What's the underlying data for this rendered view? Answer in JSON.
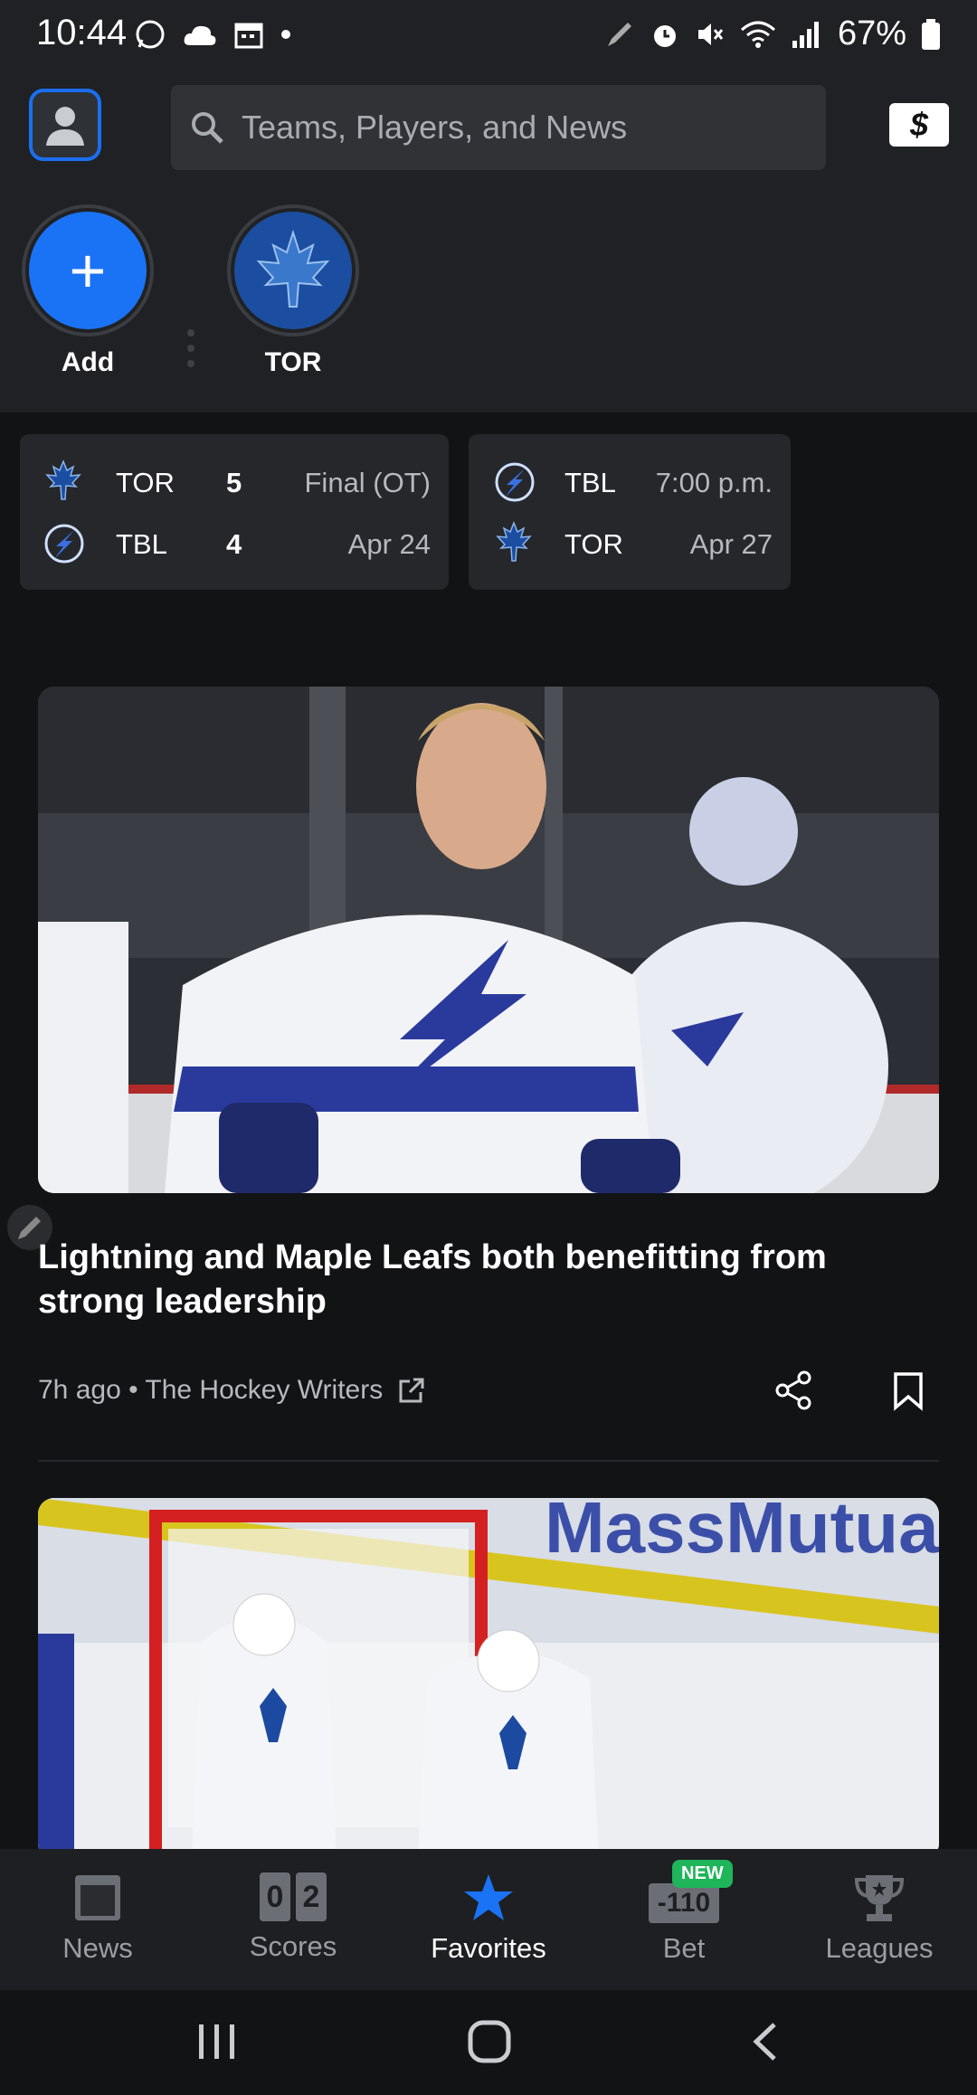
{
  "status_bar": {
    "time": "10:44",
    "battery": "67%"
  },
  "header": {
    "search_placeholder": "Teams, Players, and News",
    "favorites": [
      {
        "label": "Add"
      },
      {
        "label": "TOR"
      }
    ]
  },
  "games": [
    {
      "rows": [
        {
          "team": "TOR",
          "score": "5",
          "info": "Final (OT)"
        },
        {
          "team": "TBL",
          "score": "4",
          "info": "Apr 24"
        }
      ]
    },
    {
      "rows": [
        {
          "team": "TBL",
          "info": "7:00 p.m."
        },
        {
          "team": "TOR",
          "info": "Apr 27"
        }
      ]
    }
  ],
  "articles": [
    {
      "headline": "Lightning and Maple Leafs both benefitting from strong leadership",
      "meta": "7h ago • The Hockey Writers"
    },
    {
      "banner_text": "MassMutual"
    }
  ],
  "tabs": [
    {
      "label": "News"
    },
    {
      "label": "Scores",
      "score_a": "0",
      "score_b": "2"
    },
    {
      "label": "Favorites"
    },
    {
      "label": "Bet",
      "badge": "NEW",
      "odds": "-110"
    },
    {
      "label": "Leagues"
    }
  ],
  "colors": {
    "accent": "#1a73f5",
    "badge": "#1fb55a",
    "background": "#121315"
  }
}
